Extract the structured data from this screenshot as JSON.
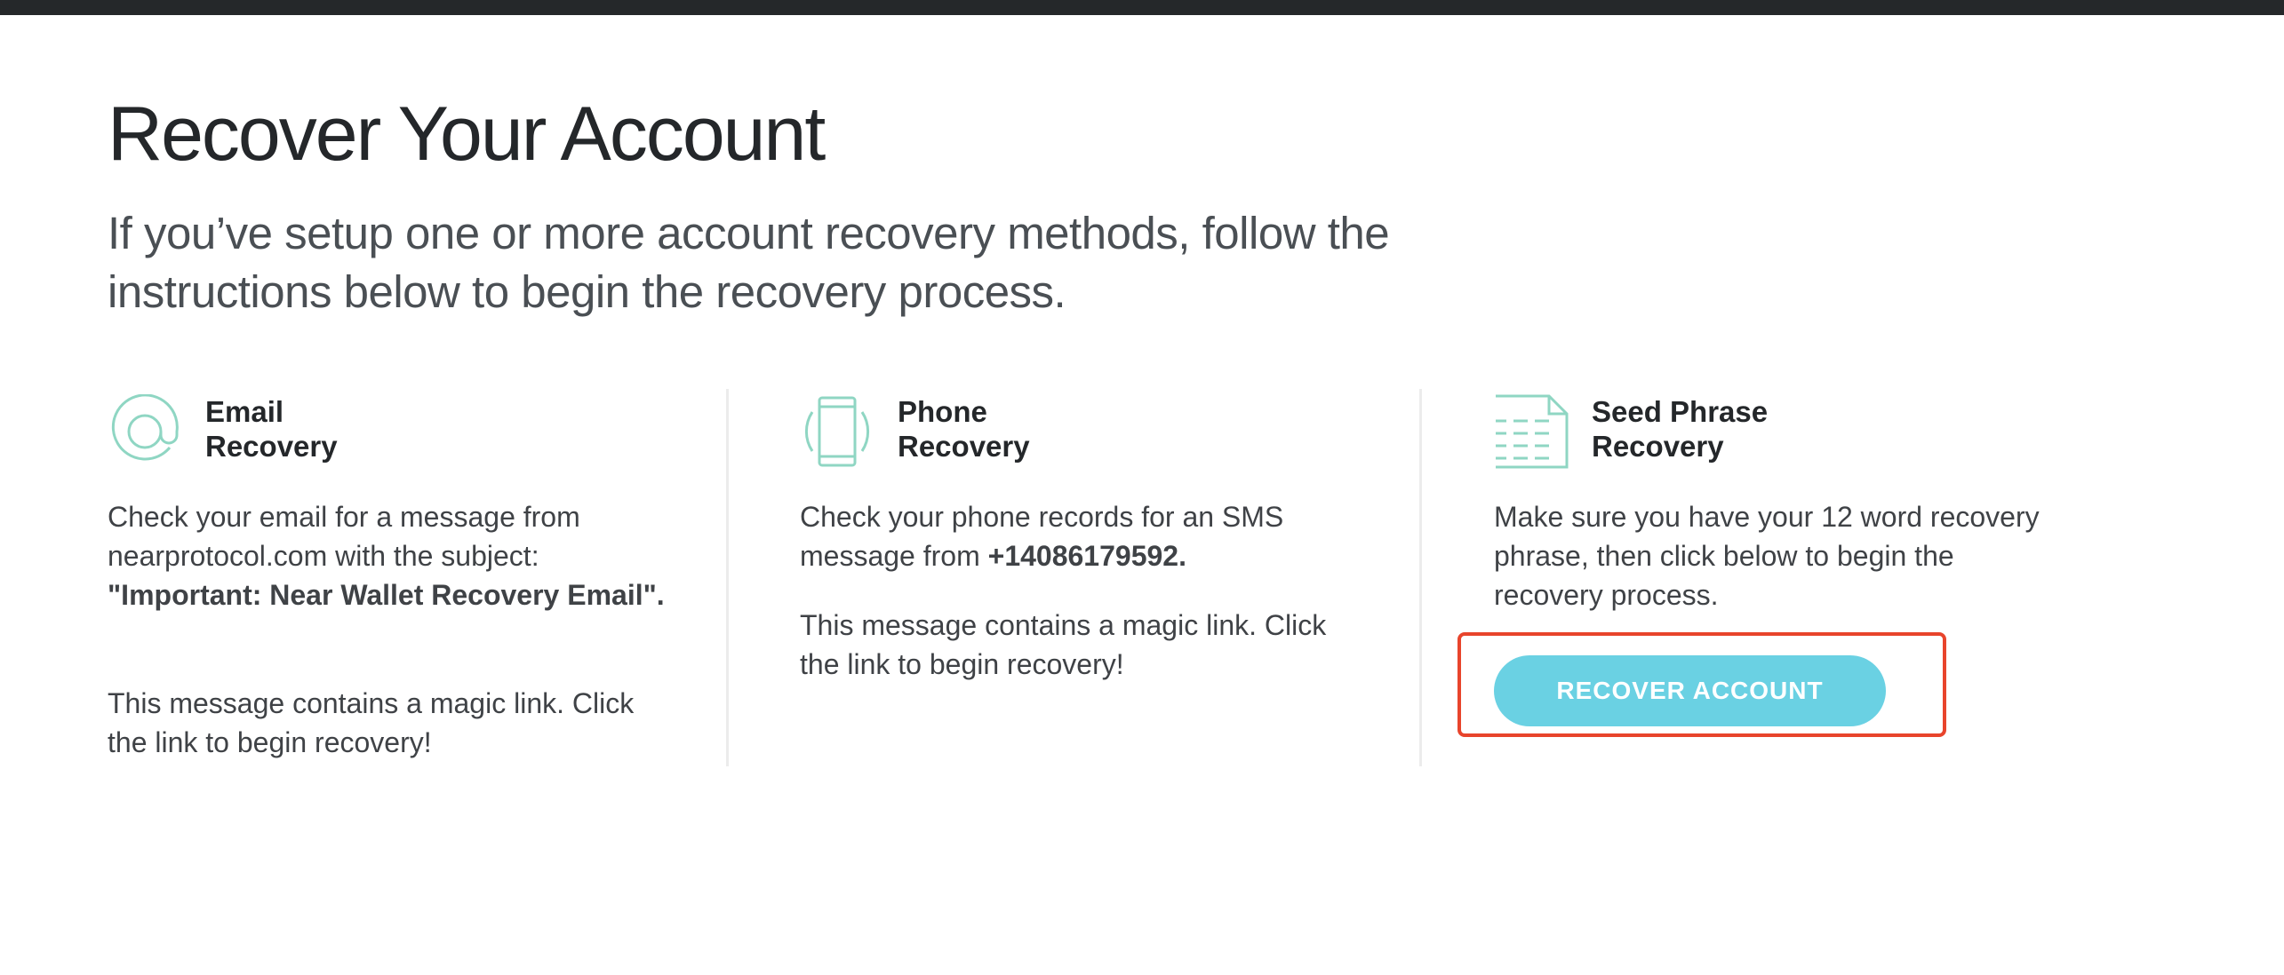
{
  "header": {
    "title": "Recover Your Account",
    "subtitle": "If you’ve setup one or more account recovery methods, follow the instructions below to begin the recovery process."
  },
  "methods": [
    {
      "icon": "at-sign-icon",
      "title_line1": "Email",
      "title_line2": "Recovery",
      "text_1_prefix": "Check your email for a message from nearprotocol.com with the subject:",
      "text_1_bold": "\"Important: Near Wallet Recovery Email\".",
      "text_2": "This message contains a magic link. Click the link to begin recovery!"
    },
    {
      "icon": "phone-icon",
      "title_line1": "Phone",
      "title_line2": "Recovery",
      "text_1_prefix": "Check your phone records for an SMS message from",
      "text_1_bold": "+14086179592.",
      "text_2": "This message contains a magic link. Click the link to begin recovery!"
    },
    {
      "icon": "document-icon",
      "title_line1": "Seed Phrase",
      "title_line2": "Recovery",
      "text_1": "Make sure you have your 12 word recovery phrase, then click below to begin the recovery process.",
      "button_label": "RECOVER ACCOUNT"
    }
  ],
  "colors": {
    "accent": "#6ad1e3",
    "icon": "#8fd6c3",
    "highlight": "#e8442c",
    "topbar": "#25282a"
  }
}
